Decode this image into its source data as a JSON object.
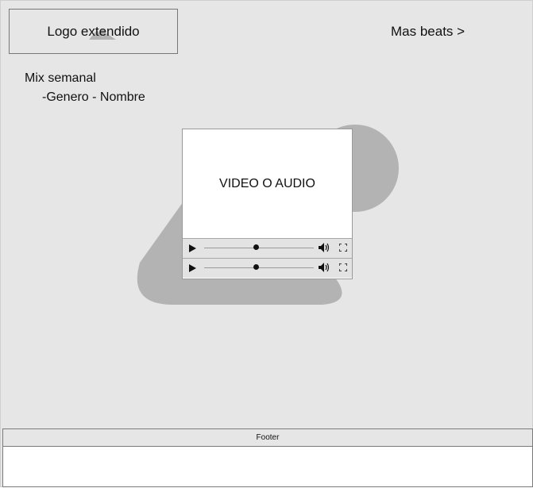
{
  "header": {
    "logo_text": "Logo extendido",
    "more_link": "Mas beats >"
  },
  "mix": {
    "title": "Mix semanal",
    "subtitle": "-Genero - Nombre"
  },
  "player": {
    "media_label": "VIDEO O AUDIO"
  },
  "footer": {
    "label": "Footer"
  },
  "icons": {
    "logo": "image-placeholder-icon",
    "play": "play-icon",
    "volume": "volume-icon",
    "fullscreen": "fullscreen-icon"
  },
  "colors": {
    "background": "#e6e6e6",
    "blob": "#b3b3b3",
    "border": "#777777"
  }
}
